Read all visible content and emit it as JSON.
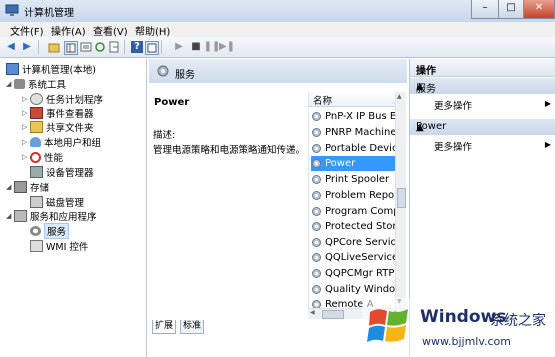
{
  "window": {
    "title": "计算机管理",
    "minimize": "–",
    "maximize": "□",
    "close": "✕"
  },
  "menu": [
    "文件(F)",
    "操作(A)",
    "查看(V)",
    "帮助(H)"
  ],
  "tree": {
    "root": "计算机管理(本地)",
    "system_tools": "系统工具",
    "task_scheduler": "任务计划程序",
    "event_viewer": "事件查看器",
    "shared_folders": "共享文件夹",
    "local_users": "本地用户和组",
    "performance": "性能",
    "device_manager": "设备管理器",
    "storage": "存储",
    "disk_management": "磁盘管理",
    "services_apps": "服务和应用程序",
    "services": "服务",
    "wmi": "WMI 控件"
  },
  "center": {
    "header": "服务",
    "selected_service": "Power",
    "desc_label": "描述:",
    "desc_text": "管理电源策略和电源策略通知传递。",
    "column_name": "名称",
    "services": [
      "PnP-X IP Bus En",
      "PNRP Machine",
      "Portable Device",
      "Power",
      "Print Spooler",
      "Problem Repor",
      "Program Comp",
      "Protected Stora",
      "QPCore Service",
      "QQLiveService",
      "QQPCMgr RTP",
      "Quality Window",
      "Remote A"
    ],
    "selected_index": 3,
    "tabs": [
      "扩展",
      "标准"
    ]
  },
  "actions": {
    "title": "操作",
    "sections": [
      {
        "name": "服务",
        "item": "更多操作"
      },
      {
        "name": "Power",
        "item": "更多操作"
      }
    ]
  },
  "watermark": {
    "brand": "Windows",
    "suffix": "系统之家",
    "url": "www.bjjmlv.com"
  },
  "colors": {
    "selection": "#3399ff",
    "header": "#cfdcec",
    "brand": "#1f2f6a"
  }
}
